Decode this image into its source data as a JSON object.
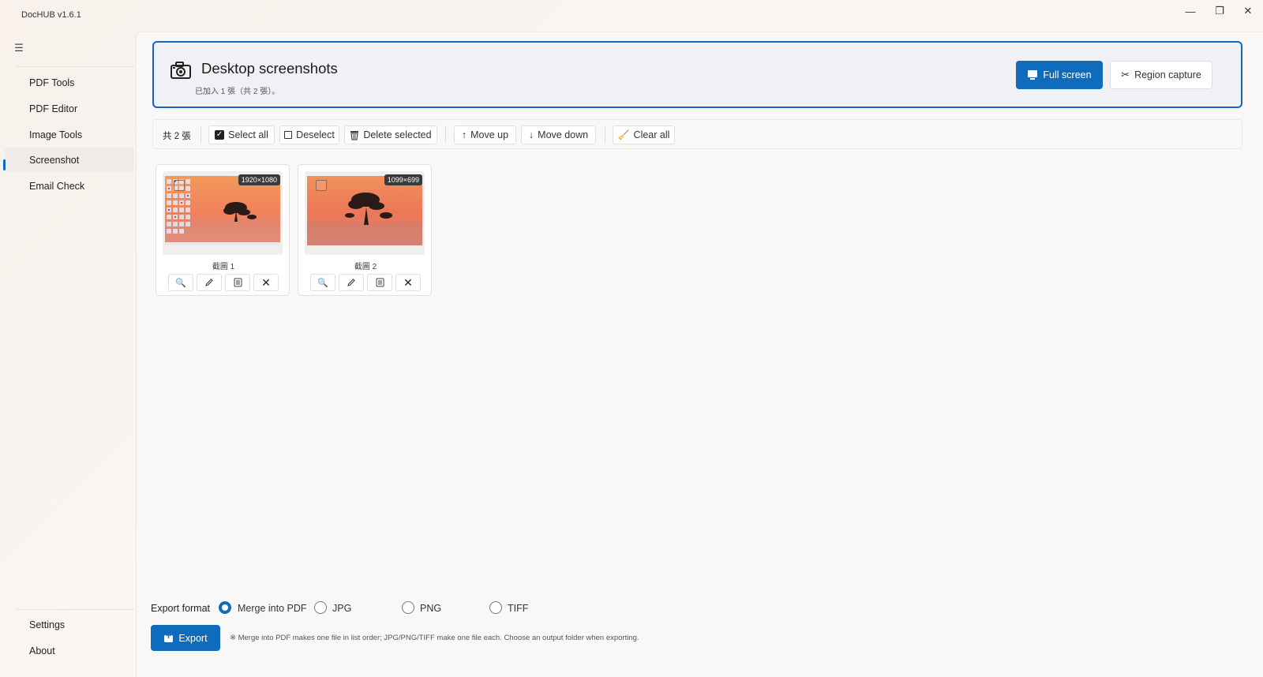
{
  "window": {
    "title": "DocHUB v1.6.1",
    "controls": {
      "minimize": "—",
      "maximize": "❐",
      "close": "✕"
    }
  },
  "sidebar": {
    "menu_icon": "hamburger-icon",
    "items": [
      {
        "label": "PDF Tools",
        "active": false
      },
      {
        "label": "PDF Editor",
        "active": false
      },
      {
        "label": "Image Tools",
        "active": false
      },
      {
        "label": "Screenshot",
        "active": true
      },
      {
        "label": "Email Check",
        "active": false
      }
    ],
    "footer_items": [
      {
        "label": "Settings"
      },
      {
        "label": "About"
      }
    ]
  },
  "header": {
    "icon": "camera-icon",
    "title": "Desktop screenshots",
    "subtitle": "已加入 1 張（共 2 張）。",
    "full_screen_label": "Full screen",
    "region_capture_label": "Region capture"
  },
  "toolbar": {
    "count": "共 2 張",
    "select_all": "Select all",
    "deselect": "Deselect",
    "delete_selected": "Delete selected",
    "move_up": "Move up",
    "move_down": "Move down",
    "clear_all": "Clear all"
  },
  "screenshots": [
    {
      "name": "截圖 1",
      "dimensions": "1920×1080",
      "checked": false
    },
    {
      "name": "截圖 2",
      "dimensions": "1099×699",
      "checked": false
    }
  ],
  "export": {
    "label": "Export format",
    "options": [
      {
        "label": "Merge into PDF",
        "selected": true
      },
      {
        "label": "JPG",
        "selected": false
      },
      {
        "label": "PNG",
        "selected": false
      },
      {
        "label": "TIFF",
        "selected": false
      }
    ],
    "button_label": "Export",
    "note": "※ Merge into PDF makes one file in list order; JPG/PNG/TIFF make one file each. Choose an output folder when exporting."
  },
  "colors": {
    "accent": "#0f6cbd",
    "header_border": "#1565c0"
  }
}
